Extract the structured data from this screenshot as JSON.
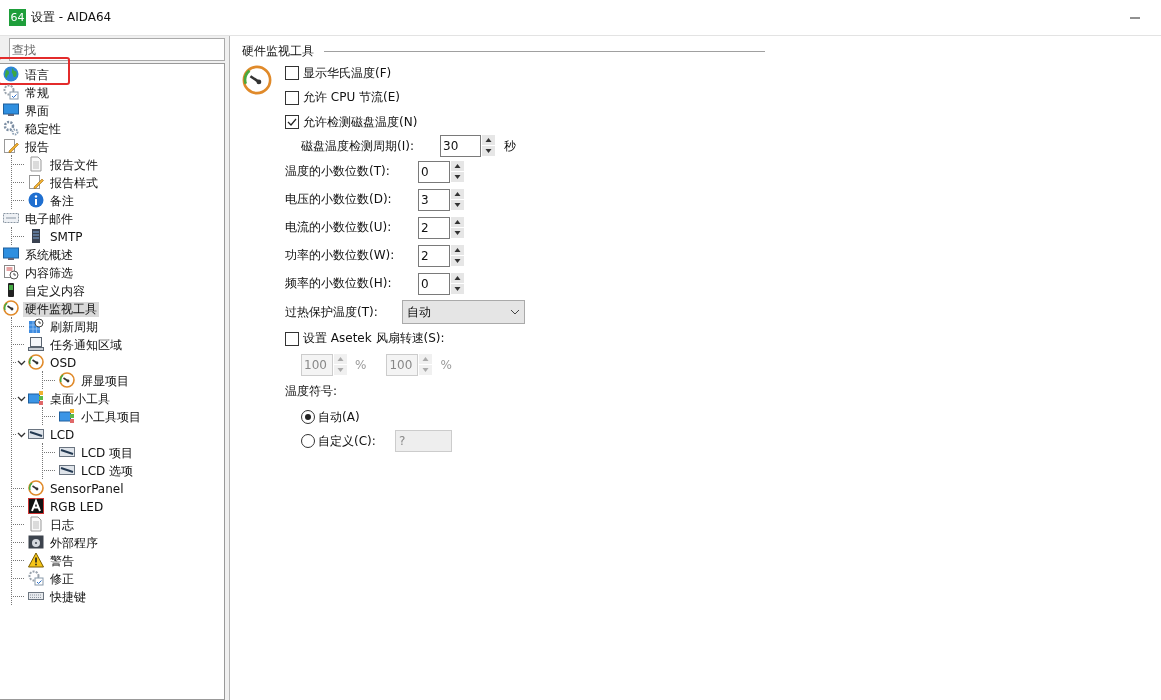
{
  "window": {
    "title": "设置 - AIDA64",
    "app_badge": "64"
  },
  "search": {
    "placeholder": "查找"
  },
  "tree": [
    {
      "label": "语言",
      "kind": "globe",
      "selected": false,
      "annotated": true
    },
    {
      "label": "常规",
      "kind": "settings",
      "selected": false
    },
    {
      "label": "界面",
      "kind": "monitor",
      "selected": false
    },
    {
      "label": "稳定性",
      "kind": "gears",
      "selected": false
    },
    {
      "label": "报告",
      "kind": "report",
      "selected": false,
      "children": [
        {
          "label": "报告文件",
          "kind": "document",
          "selected": false
        },
        {
          "label": "报告样式",
          "kind": "report",
          "selected": false
        },
        {
          "label": "备注",
          "kind": "info",
          "selected": false
        }
      ]
    },
    {
      "label": "电子邮件",
      "kind": "mail",
      "selected": false,
      "children": [
        {
          "label": "SMTP",
          "kind": "server",
          "selected": false
        }
      ]
    },
    {
      "label": "系统概述",
      "kind": "monitor",
      "selected": false
    },
    {
      "label": "内容筛选",
      "kind": "filter",
      "selected": false
    },
    {
      "label": "自定义内容",
      "kind": "device",
      "selected": false
    },
    {
      "label": "硬件监视工具",
      "kind": "gauge",
      "selected": true,
      "children": [
        {
          "label": "刷新周期",
          "kind": "refresh",
          "selected": false
        },
        {
          "label": "任务通知区域",
          "kind": "taskbar",
          "selected": false
        },
        {
          "label": "OSD",
          "kind": "gauge",
          "selected": false,
          "expanded": true,
          "children": [
            {
              "label": "屏显项目",
              "kind": "gauge",
              "selected": false
            }
          ]
        },
        {
          "label": "桌面小工具",
          "kind": "gadget",
          "selected": false,
          "expanded": true,
          "children": [
            {
              "label": "小工具项目",
              "kind": "gadget",
              "selected": false
            }
          ]
        },
        {
          "label": "LCD",
          "kind": "lcd",
          "selected": false,
          "expanded": true,
          "children": [
            {
              "label": "LCD 项目",
              "kind": "lcd",
              "selected": false
            },
            {
              "label": "LCD 选项",
              "kind": "lcd",
              "selected": false
            }
          ]
        },
        {
          "label": "SensorPanel",
          "kind": "gauge",
          "selected": false
        },
        {
          "label": "RGB LED",
          "kind": "rgb",
          "selected": false
        },
        {
          "label": "日志",
          "kind": "document",
          "selected": false
        },
        {
          "label": "外部程序",
          "kind": "program",
          "selected": false
        },
        {
          "label": "警告",
          "kind": "warning",
          "selected": false
        },
        {
          "label": "修正",
          "kind": "settings",
          "selected": false
        },
        {
          "label": "快捷键",
          "kind": "keyboard",
          "selected": false
        }
      ]
    }
  ],
  "panel": {
    "title": "硬件监视工具",
    "controls": [
      {
        "kind": "checkbox",
        "label": "显示华氏温度(F)",
        "checked": false
      },
      {
        "kind": "checkbox",
        "label": "允许 CPU 节流(E)",
        "checked": false
      },
      {
        "kind": "checkbox",
        "label": "允许检测磁盘温度(N)",
        "checked": true
      },
      {
        "kind": "sub_spin",
        "label": "磁盘温度检测周期(I):",
        "value": "30",
        "unit": "秒"
      },
      {
        "kind": "spin",
        "label": "温度的小数位数(T):",
        "value": "0"
      },
      {
        "kind": "spin",
        "label": "电压的小数位数(D):",
        "value": "3"
      },
      {
        "kind": "spin",
        "label": "电流的小数位数(U):",
        "value": "2"
      },
      {
        "kind": "spin",
        "label": "功率的小数位数(W):",
        "value": "2"
      },
      {
        "kind": "spin",
        "label": "频率的小数位数(H):",
        "value": "0"
      },
      {
        "kind": "select",
        "label": "过热保护温度(T):",
        "value": "自动"
      },
      {
        "kind": "checkbox",
        "label": "设置 Asetek 风扇转速(S):",
        "checked": false
      },
      {
        "kind": "spin_pair",
        "disabled": true,
        "fields": [
          {
            "value": "100",
            "unit": "%"
          },
          {
            "value": "100",
            "unit": "%"
          }
        ]
      },
      {
        "kind": "heading",
        "label": "温度符号:"
      },
      {
        "kind": "radio",
        "label": "自动(A)",
        "selected": true
      },
      {
        "kind": "radio",
        "label": "自定义(C):",
        "selected": false,
        "field": {
          "placeholder": "?"
        }
      }
    ]
  }
}
